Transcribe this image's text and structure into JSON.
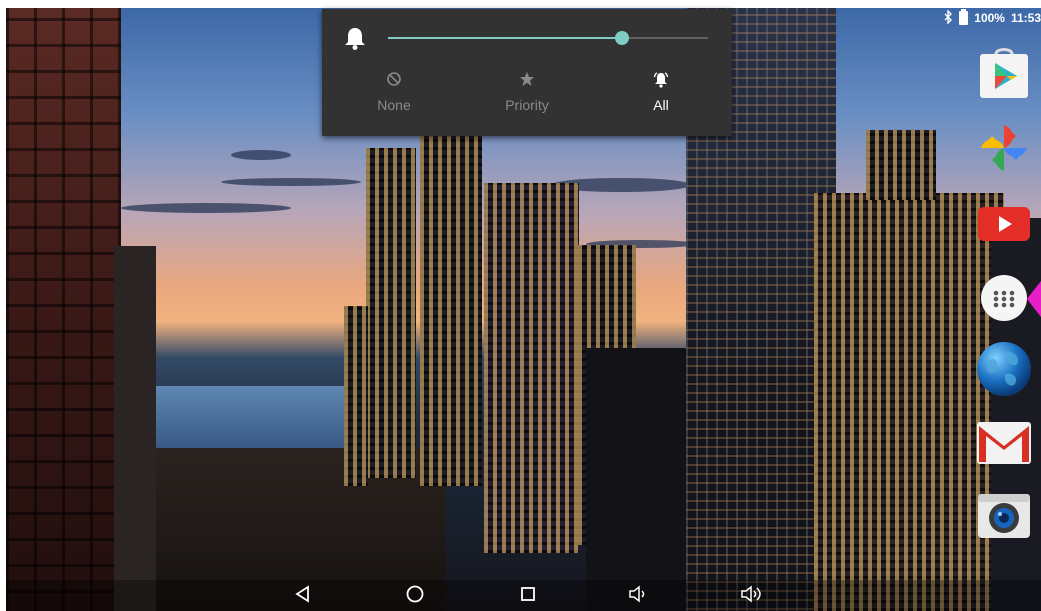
{
  "status_bar": {
    "icons": [
      "bluetooth-icon",
      "battery-icon"
    ],
    "battery": "100%",
    "time": "11:53"
  },
  "volume_panel": {
    "type": "notification",
    "icon": "bell-icon",
    "slider_level": 0.73,
    "accent": "#80cbc4",
    "modes": [
      {
        "label": "None",
        "icon": "none-icon"
      },
      {
        "label": "Priority",
        "icon": "star-icon"
      },
      {
        "label": "All",
        "icon": "bell-active-icon",
        "selected": true
      }
    ]
  },
  "dock": {
    "apps": [
      {
        "name": "play-store",
        "icon": "play-store-icon"
      },
      {
        "name": "photos",
        "icon": "photos-icon"
      },
      {
        "name": "youtube",
        "icon": "youtube-icon"
      },
      {
        "name": "all-apps",
        "icon": "app-drawer-icon"
      },
      {
        "name": "browser",
        "icon": "globe-icon"
      },
      {
        "name": "gmail",
        "icon": "gmail-icon"
      },
      {
        "name": "camera",
        "icon": "camera-icon"
      }
    ],
    "highlight_color": "#e91ec9"
  },
  "nav_bar": {
    "buttons": [
      "back-icon",
      "home-icon",
      "recents-icon",
      "volume-down-icon",
      "volume-up-icon"
    ]
  }
}
